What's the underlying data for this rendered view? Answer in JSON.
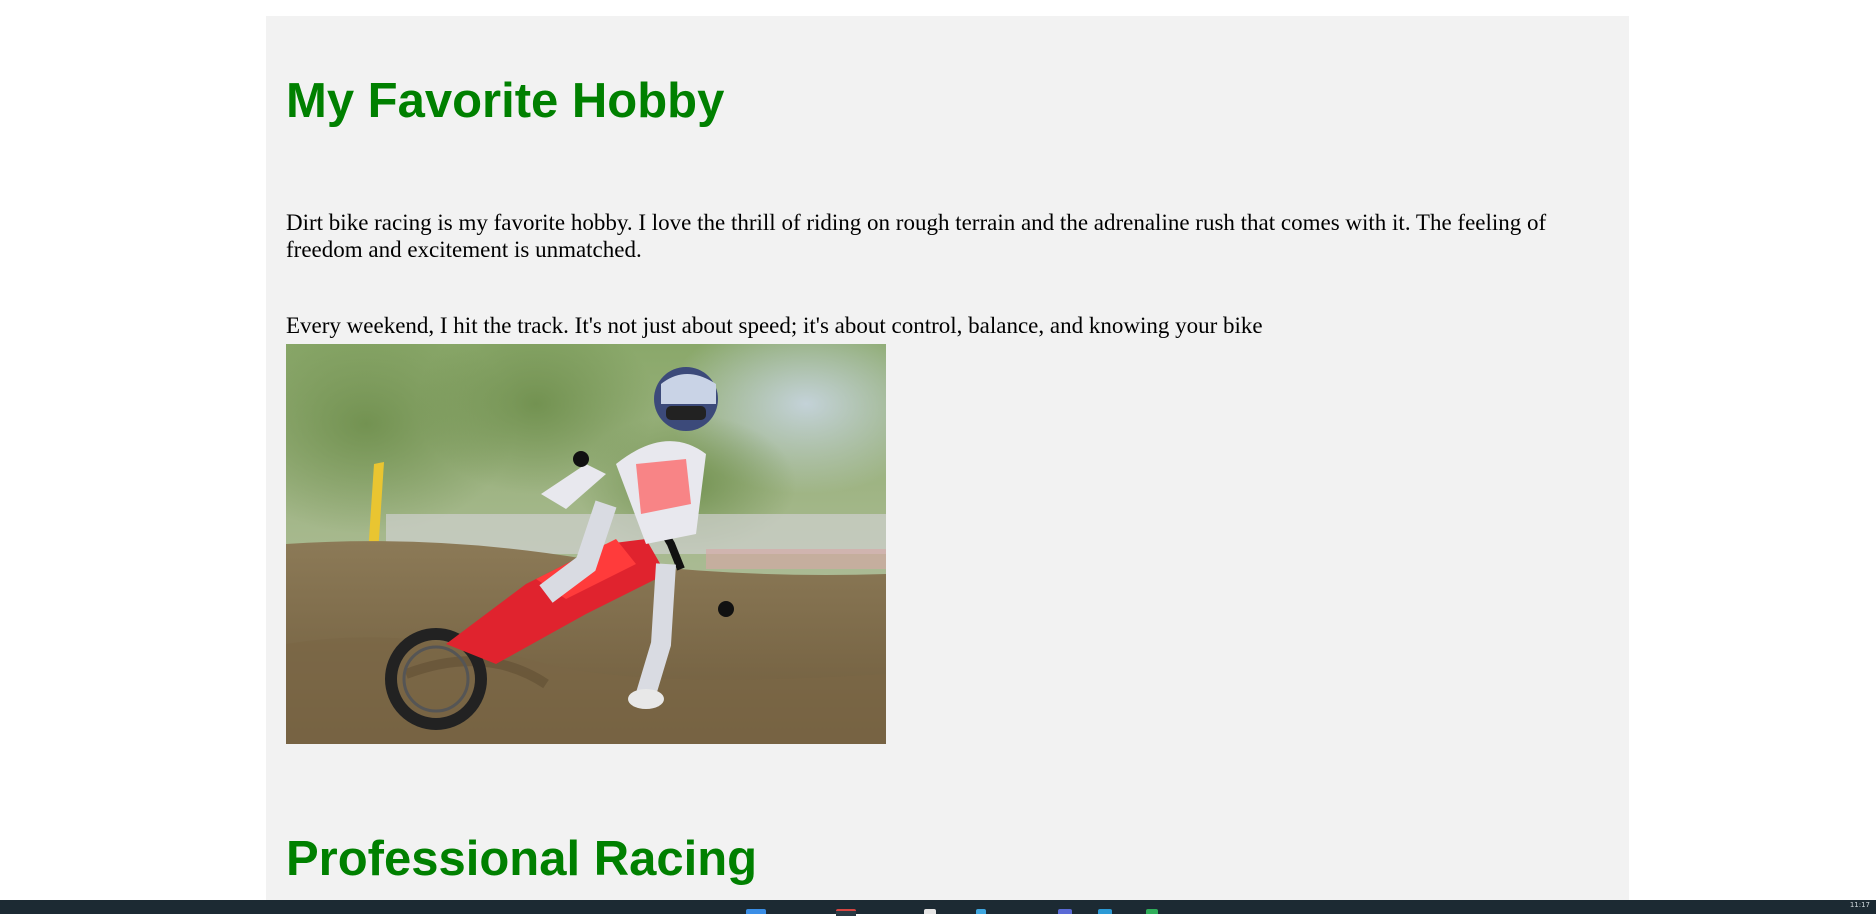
{
  "page": {
    "heading1": "My Favorite Hobby",
    "paragraph1": "Dirt bike racing is my favorite hobby. I love the thrill of riding on rough terrain and the adrenaline rush that comes with it. The feeling of freedom and excitement is unmatched.",
    "paragraph2": "Every weekend, I hit the track. It's not just about speed; it's about control, balance, and knowing your bike",
    "image_description": "motocross rider on red dirt bike cornering in dirt",
    "heading2": "Professional Racing"
  },
  "colors": {
    "heading": "#008000",
    "page_background": "#f2f2f2",
    "taskbar": "#1c2a33"
  },
  "taskbar": {
    "clock": "11:17",
    "icons": [
      "windows-icon",
      "browser-icon",
      "file-explorer-icon",
      "store-icon",
      "edge-icon",
      "mail-icon",
      "chrome-icon"
    ]
  }
}
